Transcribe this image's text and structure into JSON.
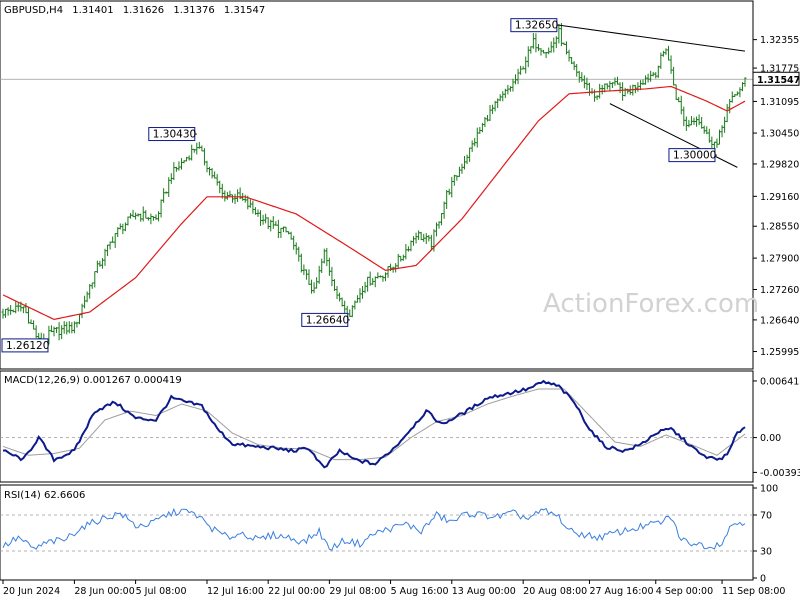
{
  "header": {
    "symbol": "GBPUSD,H4",
    "open": "1.31401",
    "high": "1.31626",
    "low": "1.31376",
    "close": "1.31547"
  },
  "watermark": "ActionForex.com",
  "current_price_label": "1.31547",
  "colors": {
    "candle": "#1b7a1b",
    "ma": "#e01818",
    "macd": "#0c1a8c",
    "signal": "#9e9e9e",
    "rsi": "#3b7fe0",
    "trendline": "#000000",
    "label_border": "#0c1a8c"
  },
  "chart_data": [
    {
      "type": "candlestick",
      "panel": "price",
      "title": "GBPUSD,H4",
      "ylim": [
        1.257,
        1.33
      ],
      "yticks": [
        "1.32355",
        "1.31775",
        "1.31095",
        "1.30450",
        "1.29820",
        "1.29160",
        "1.28550",
        "1.27900",
        "1.27260",
        "1.26640",
        "1.25995"
      ],
      "xticks": [
        "20 Jun 2024",
        "28 Jun 00:00",
        "5 Jul 08:00",
        "12 Jul 16:00",
        "22 Jul 00:00",
        "29 Jul 08:00",
        "5 Aug 16:00",
        "13 Aug 00:00",
        "20 Aug 08:00",
        "27 Aug 16:00",
        "4 Sep 00:00",
        "11 Sep 08:00"
      ],
      "key_points": [
        {
          "t": 0,
          "p": 1.268
        },
        {
          "t": 8,
          "p": 1.269
        },
        {
          "t": 14,
          "p": 1.262
        },
        {
          "t": 20,
          "p": 1.264
        },
        {
          "t": 28,
          "p": 1.265
        },
        {
          "t": 36,
          "p": 1.276
        },
        {
          "t": 44,
          "p": 1.284
        },
        {
          "t": 52,
          "p": 1.288
        },
        {
          "t": 60,
          "p": 1.287
        },
        {
          "t": 66,
          "p": 1.296
        },
        {
          "t": 72,
          "p": 1.2995
        },
        {
          "t": 76,
          "p": 1.302
        },
        {
          "t": 80,
          "p": 1.298
        },
        {
          "t": 86,
          "p": 1.292
        },
        {
          "t": 92,
          "p": 1.2915
        },
        {
          "t": 98,
          "p": 1.289
        },
        {
          "t": 104,
          "p": 1.286
        },
        {
          "t": 112,
          "p": 1.284
        },
        {
          "t": 118,
          "p": 1.276
        },
        {
          "t": 122,
          "p": 1.272
        },
        {
          "t": 126,
          "p": 1.28
        },
        {
          "t": 132,
          "p": 1.27
        },
        {
          "t": 136,
          "p": 1.268
        },
        {
          "t": 142,
          "p": 1.274
        },
        {
          "t": 150,
          "p": 1.276
        },
        {
          "t": 156,
          "p": 1.279
        },
        {
          "t": 162,
          "p": 1.284
        },
        {
          "t": 168,
          "p": 1.282
        },
        {
          "t": 174,
          "p": 1.292
        },
        {
          "t": 182,
          "p": 1.3
        },
        {
          "t": 190,
          "p": 1.308
        },
        {
          "t": 196,
          "p": 1.312
        },
        {
          "t": 202,
          "p": 1.316
        },
        {
          "t": 208,
          "p": 1.323
        },
        {
          "t": 214,
          "p": 1.321
        },
        {
          "t": 218,
          "p": 1.325
        },
        {
          "t": 222,
          "p": 1.319
        },
        {
          "t": 226,
          "p": 1.316
        },
        {
          "t": 232,
          "p": 1.312
        },
        {
          "t": 238,
          "p": 1.315
        },
        {
          "t": 244,
          "p": 1.3125
        },
        {
          "t": 250,
          "p": 1.315
        },
        {
          "t": 256,
          "p": 1.317
        },
        {
          "t": 260,
          "p": 1.322
        },
        {
          "t": 264,
          "p": 1.312
        },
        {
          "t": 268,
          "p": 1.306
        },
        {
          "t": 272,
          "p": 1.308
        },
        {
          "t": 276,
          "p": 1.304
        },
        {
          "t": 280,
          "p": 1.302
        },
        {
          "t": 284,
          "p": 1.3095
        },
        {
          "t": 288,
          "p": 1.313
        },
        {
          "t": 291,
          "p": 1.315
        }
      ],
      "ma_points": [
        {
          "t": 0,
          "p": 1.2715
        },
        {
          "t": 20,
          "p": 1.2665
        },
        {
          "t": 34,
          "p": 1.268
        },
        {
          "t": 52,
          "p": 1.275
        },
        {
          "t": 70,
          "p": 1.286
        },
        {
          "t": 80,
          "p": 1.2915
        },
        {
          "t": 95,
          "p": 1.2915
        },
        {
          "t": 115,
          "p": 1.288
        },
        {
          "t": 135,
          "p": 1.2815
        },
        {
          "t": 150,
          "p": 1.2765
        },
        {
          "t": 162,
          "p": 1.2775
        },
        {
          "t": 180,
          "p": 1.287
        },
        {
          "t": 195,
          "p": 1.297
        },
        {
          "t": 210,
          "p": 1.307
        },
        {
          "t": 222,
          "p": 1.3125
        },
        {
          "t": 235,
          "p": 1.313
        },
        {
          "t": 252,
          "p": 1.3135
        },
        {
          "t": 262,
          "p": 1.314
        },
        {
          "t": 276,
          "p": 1.311
        },
        {
          "t": 284,
          "p": 1.309
        },
        {
          "t": 291,
          "p": 1.311
        }
      ],
      "annotations": [
        {
          "label": "1.32650",
          "t": 218,
          "p": 1.3265
        },
        {
          "label": "1.30430",
          "t": 76,
          "p": 1.3043
        },
        {
          "label": "1.30000",
          "t": 280,
          "p": 1.3
        },
        {
          "label": "1.26640",
          "t": 136,
          "p": 1.2664
        },
        {
          "label": "1.26120",
          "t": 14,
          "p": 1.2612
        }
      ],
      "trendlines": [
        {
          "from": {
            "t": 218,
            "p": 1.3265
          },
          "to": {
            "t": 291,
            "p": 1.3212
          }
        },
        {
          "from": {
            "t": 238,
            "p": 1.3105
          },
          "to": {
            "t": 288,
            "p": 1.2975
          }
        }
      ]
    },
    {
      "type": "line",
      "panel": "macd",
      "title": "MACD(12,26,9) 0.001267 0.000419",
      "ylim": [
        -0.0048,
        0.0072
      ],
      "yticks": [
        "0.006413",
        "0.00",
        "-0.003938"
      ],
      "series": [
        {
          "name": "MACD",
          "points": [
            {
              "t": 0,
              "v": -0.0015
            },
            {
              "t": 8,
              "v": -0.0025
            },
            {
              "t": 14,
              "v": 0.0
            },
            {
              "t": 20,
              "v": -0.0025
            },
            {
              "t": 28,
              "v": -0.0015
            },
            {
              "t": 36,
              "v": 0.003
            },
            {
              "t": 44,
              "v": 0.004
            },
            {
              "t": 52,
              "v": 0.0022
            },
            {
              "t": 60,
              "v": 0.002
            },
            {
              "t": 66,
              "v": 0.0045
            },
            {
              "t": 72,
              "v": 0.004
            },
            {
              "t": 78,
              "v": 0.0036
            },
            {
              "t": 84,
              "v": 0.001
            },
            {
              "t": 90,
              "v": -0.0007
            },
            {
              "t": 98,
              "v": -0.001
            },
            {
              "t": 106,
              "v": -0.0012
            },
            {
              "t": 114,
              "v": -0.0015
            },
            {
              "t": 120,
              "v": -0.0012
            },
            {
              "t": 126,
              "v": -0.0035
            },
            {
              "t": 132,
              "v": -0.0015
            },
            {
              "t": 138,
              "v": -0.0025
            },
            {
              "t": 146,
              "v": -0.003
            },
            {
              "t": 154,
              "v": -0.001
            },
            {
              "t": 160,
              "v": 0.001
            },
            {
              "t": 166,
              "v": 0.003
            },
            {
              "t": 172,
              "v": 0.0015
            },
            {
              "t": 182,
              "v": 0.003
            },
            {
              "t": 190,
              "v": 0.0045
            },
            {
              "t": 198,
              "v": 0.005
            },
            {
              "t": 206,
              "v": 0.0055
            },
            {
              "t": 212,
              "v": 0.0063
            },
            {
              "t": 218,
              "v": 0.0058
            },
            {
              "t": 224,
              "v": 0.004
            },
            {
              "t": 230,
              "v": 0.001
            },
            {
              "t": 236,
              "v": -0.001
            },
            {
              "t": 244,
              "v": -0.0015
            },
            {
              "t": 250,
              "v": -0.0008
            },
            {
              "t": 256,
              "v": 0.0005
            },
            {
              "t": 262,
              "v": 0.001
            },
            {
              "t": 268,
              "v": -0.0005
            },
            {
              "t": 274,
              "v": -0.002
            },
            {
              "t": 280,
              "v": -0.0025
            },
            {
              "t": 284,
              "v": -0.002
            },
            {
              "t": 288,
              "v": 0.0005
            },
            {
              "t": 291,
              "v": 0.0013
            }
          ]
        },
        {
          "name": "Signal",
          "points": [
            {
              "t": 0,
              "v": -0.001
            },
            {
              "t": 10,
              "v": -0.002
            },
            {
              "t": 20,
              "v": -0.0018
            },
            {
              "t": 30,
              "v": -0.0012
            },
            {
              "t": 40,
              "v": 0.002
            },
            {
              "t": 50,
              "v": 0.003
            },
            {
              "t": 60,
              "v": 0.0025
            },
            {
              "t": 70,
              "v": 0.0038
            },
            {
              "t": 80,
              "v": 0.003
            },
            {
              "t": 90,
              "v": 0.0005
            },
            {
              "t": 100,
              "v": -0.0008
            },
            {
              "t": 110,
              "v": -0.0012
            },
            {
              "t": 120,
              "v": -0.0013
            },
            {
              "t": 130,
              "v": -0.0025
            },
            {
              "t": 140,
              "v": -0.0025
            },
            {
              "t": 150,
              "v": -0.0022
            },
            {
              "t": 160,
              "v": 0.0
            },
            {
              "t": 170,
              "v": 0.0018
            },
            {
              "t": 180,
              "v": 0.0025
            },
            {
              "t": 190,
              "v": 0.0038
            },
            {
              "t": 200,
              "v": 0.0047
            },
            {
              "t": 210,
              "v": 0.0055
            },
            {
              "t": 220,
              "v": 0.0055
            },
            {
              "t": 230,
              "v": 0.0025
            },
            {
              "t": 240,
              "v": -0.0005
            },
            {
              "t": 250,
              "v": -0.001
            },
            {
              "t": 260,
              "v": 0.0003
            },
            {
              "t": 270,
              "v": -0.0008
            },
            {
              "t": 280,
              "v": -0.002
            },
            {
              "t": 291,
              "v": 0.0004
            }
          ]
        }
      ]
    },
    {
      "type": "line",
      "panel": "rsi",
      "title": "RSI(14) 62.6606",
      "ylim": [
        0,
        100
      ],
      "yticks": [
        "100",
        "70",
        "30",
        "0"
      ],
      "series": [
        {
          "name": "RSI",
          "points": [
            {
              "t": 0,
              "v": 35
            },
            {
              "t": 6,
              "v": 45
            },
            {
              "t": 12,
              "v": 32
            },
            {
              "t": 18,
              "v": 40
            },
            {
              "t": 24,
              "v": 42
            },
            {
              "t": 30,
              "v": 55
            },
            {
              "t": 38,
              "v": 65
            },
            {
              "t": 46,
              "v": 72
            },
            {
              "t": 52,
              "v": 58
            },
            {
              "t": 58,
              "v": 60
            },
            {
              "t": 64,
              "v": 70
            },
            {
              "t": 70,
              "v": 75
            },
            {
              "t": 76,
              "v": 70
            },
            {
              "t": 82,
              "v": 55
            },
            {
              "t": 88,
              "v": 45
            },
            {
              "t": 94,
              "v": 50
            },
            {
              "t": 100,
              "v": 42
            },
            {
              "t": 106,
              "v": 48
            },
            {
              "t": 112,
              "v": 45
            },
            {
              "t": 118,
              "v": 40
            },
            {
              "t": 124,
              "v": 52
            },
            {
              "t": 128,
              "v": 32
            },
            {
              "t": 134,
              "v": 42
            },
            {
              "t": 140,
              "v": 38
            },
            {
              "t": 146,
              "v": 50
            },
            {
              "t": 152,
              "v": 55
            },
            {
              "t": 158,
              "v": 60
            },
            {
              "t": 164,
              "v": 52
            },
            {
              "t": 170,
              "v": 70
            },
            {
              "t": 176,
              "v": 62
            },
            {
              "t": 182,
              "v": 72
            },
            {
              "t": 188,
              "v": 70
            },
            {
              "t": 194,
              "v": 68
            },
            {
              "t": 200,
              "v": 72
            },
            {
              "t": 206,
              "v": 66
            },
            {
              "t": 212,
              "v": 75
            },
            {
              "t": 218,
              "v": 68
            },
            {
              "t": 222,
              "v": 52
            },
            {
              "t": 228,
              "v": 48
            },
            {
              "t": 234,
              "v": 45
            },
            {
              "t": 240,
              "v": 50
            },
            {
              "t": 246,
              "v": 54
            },
            {
              "t": 252,
              "v": 58
            },
            {
              "t": 258,
              "v": 62
            },
            {
              "t": 262,
              "v": 68
            },
            {
              "t": 266,
              "v": 42
            },
            {
              "t": 272,
              "v": 38
            },
            {
              "t": 278,
              "v": 35
            },
            {
              "t": 282,
              "v": 40
            },
            {
              "t": 286,
              "v": 60
            },
            {
              "t": 291,
              "v": 63
            }
          ]
        }
      ]
    }
  ]
}
